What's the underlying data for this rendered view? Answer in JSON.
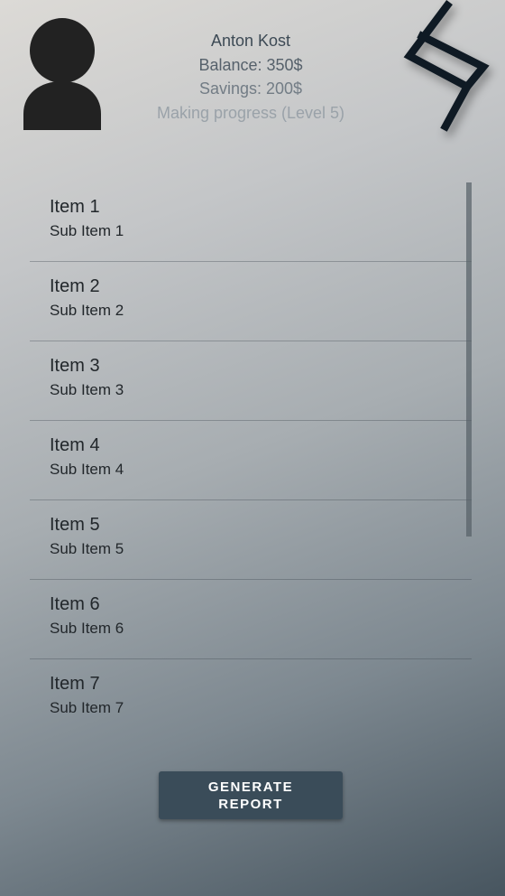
{
  "profile": {
    "avatar_icon": "user-avatar-icon",
    "name": "Anton Kost",
    "balance": "Balance: 350$",
    "savings": "Savings: 200$",
    "progress": "Making progress (Level 5)"
  },
  "logo": {
    "icon": "brand-logo-icon",
    "color": "#0f1a24"
  },
  "list": {
    "items": [
      {
        "title": "Item 1",
        "subtitle": "Sub Item 1"
      },
      {
        "title": "Item 2",
        "subtitle": "Sub Item 2"
      },
      {
        "title": "Item 3",
        "subtitle": "Sub Item 3"
      },
      {
        "title": "Item 4",
        "subtitle": "Sub Item 4"
      },
      {
        "title": "Item 5",
        "subtitle": "Sub Item 5"
      },
      {
        "title": "Item 6",
        "subtitle": "Sub Item 6"
      },
      {
        "title": "Item 7",
        "subtitle": "Sub Item 7"
      }
    ]
  },
  "actions": {
    "generate_label": "GENERATE\nREPORT",
    "button_color": "#3a4c59"
  }
}
